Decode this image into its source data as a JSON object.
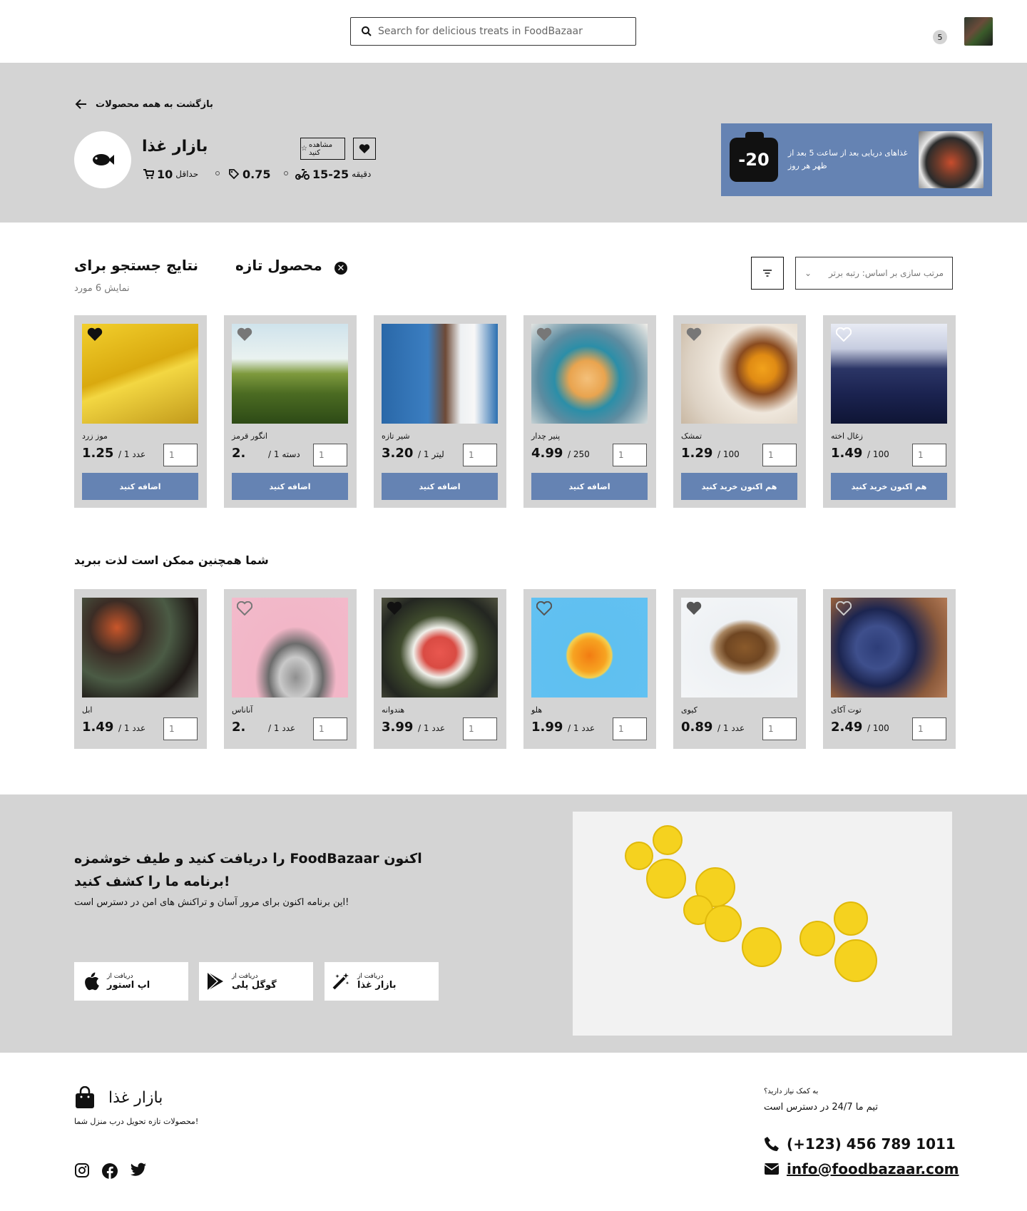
{
  "header": {
    "search_placeholder": "Search for delicious treats in FoodBazaar",
    "cart_count": "5"
  },
  "store": {
    "back_label": "بازگشت به همه محصولات",
    "name": "بازار غذا",
    "rate_label": "مشاهده کنید",
    "min_order_value": "10",
    "min_order_label": "حداقل",
    "fee_value": "0.75",
    "time_value": "15-25",
    "time_unit": "دقیقه",
    "promo_badge": "-20",
    "promo_text": "غذاهای دریایی بعد از ساعت 5 بعد از ظهر هر روز"
  },
  "results": {
    "title": "نتایج جستجو برای",
    "query": "محصول تازه",
    "count": "نمایش 6 مورد",
    "sort_label": "مرتب سازی بر اساس: رتبه برتر"
  },
  "products": [
    {
      "name": "موز زرد",
      "price": "1.25",
      "unit": "/ 1 عدد",
      "qty": "1",
      "button": "اضافه کنید",
      "fav": true
    },
    {
      "name": "انگور قرمز",
      "price": "2.",
      "unit": "/ 1 دسته",
      "qty": "1",
      "button": "اضافه کنید",
      "fav": false
    },
    {
      "name": "شیر تازه",
      "price": "3.20",
      "unit": "/ 1 لیتر",
      "qty": "1",
      "button": "اضافه کنید",
      "fav": false
    },
    {
      "name": "پنیر چدار",
      "price": "4.99",
      "unit": "/ 250",
      "qty": "1",
      "button": "اضافه کنید",
      "fav": false
    },
    {
      "name": "تمشک",
      "price": "1.29",
      "unit": "/ 100",
      "qty": "1",
      "button": "هم اکنون خرید کنید",
      "fav": false
    },
    {
      "name": "زغال اخته",
      "price": "1.49",
      "unit": "/ 100",
      "qty": "1",
      "button": "هم اکنون خرید کنید",
      "fav": false
    }
  ],
  "related": {
    "title": "شما همچنین ممکن است لذت ببرید",
    "items": [
      {
        "name": "ابل",
        "price": "1.49",
        "unit": "/ 1 عدد",
        "qty": "1",
        "fav": false
      },
      {
        "name": "آناناس",
        "price": "2.",
        "unit": "/ 1 عدد",
        "qty": "1",
        "fav": false
      },
      {
        "name": "هندوانه",
        "price": "3.99",
        "unit": "/ 1 عدد",
        "qty": "1",
        "fav": true
      },
      {
        "name": "هلو",
        "price": "1.99",
        "unit": "/ 1 عدد",
        "qty": "1",
        "fav": false
      },
      {
        "name": "کیوی",
        "price": "0.89",
        "unit": "/ 1 عدد",
        "qty": "1",
        "fav": false
      },
      {
        "name": "توت آکای",
        "price": "2.49",
        "unit": "/ 100",
        "qty": "1",
        "fav": false
      }
    ]
  },
  "app": {
    "title": "را دریافت کنید و طیف خوشمزه FoodBazaar اکنون برنامه ما را کشف کنید!",
    "subtitle": "این برنامه اکنون برای مرور آسان و تراکنش های امن در دسترس است!",
    "buttons": [
      {
        "small": "دریافت از",
        "large": "اپ استور",
        "icon": "apple-icon"
      },
      {
        "small": "دریافت از",
        "large": "گوگل پلی",
        "icon": "google-play-icon"
      },
      {
        "small": "دریافت از",
        "large": "بازار غذا",
        "icon": "magic-wand-icon"
      }
    ]
  },
  "footer": {
    "brand": "بازار غذا",
    "tagline": "محصولات تازه تحویل درب منزل شما!",
    "help_question": "به کمک نیاز دارید؟",
    "help_team": "تیم ما 24/7 در دسترس است",
    "phone": "(+123) 456 789 1011",
    "email": "info@foodbazaar.com"
  },
  "colors": {
    "accent": "#6583b3",
    "panel": "#d4d4d4"
  }
}
